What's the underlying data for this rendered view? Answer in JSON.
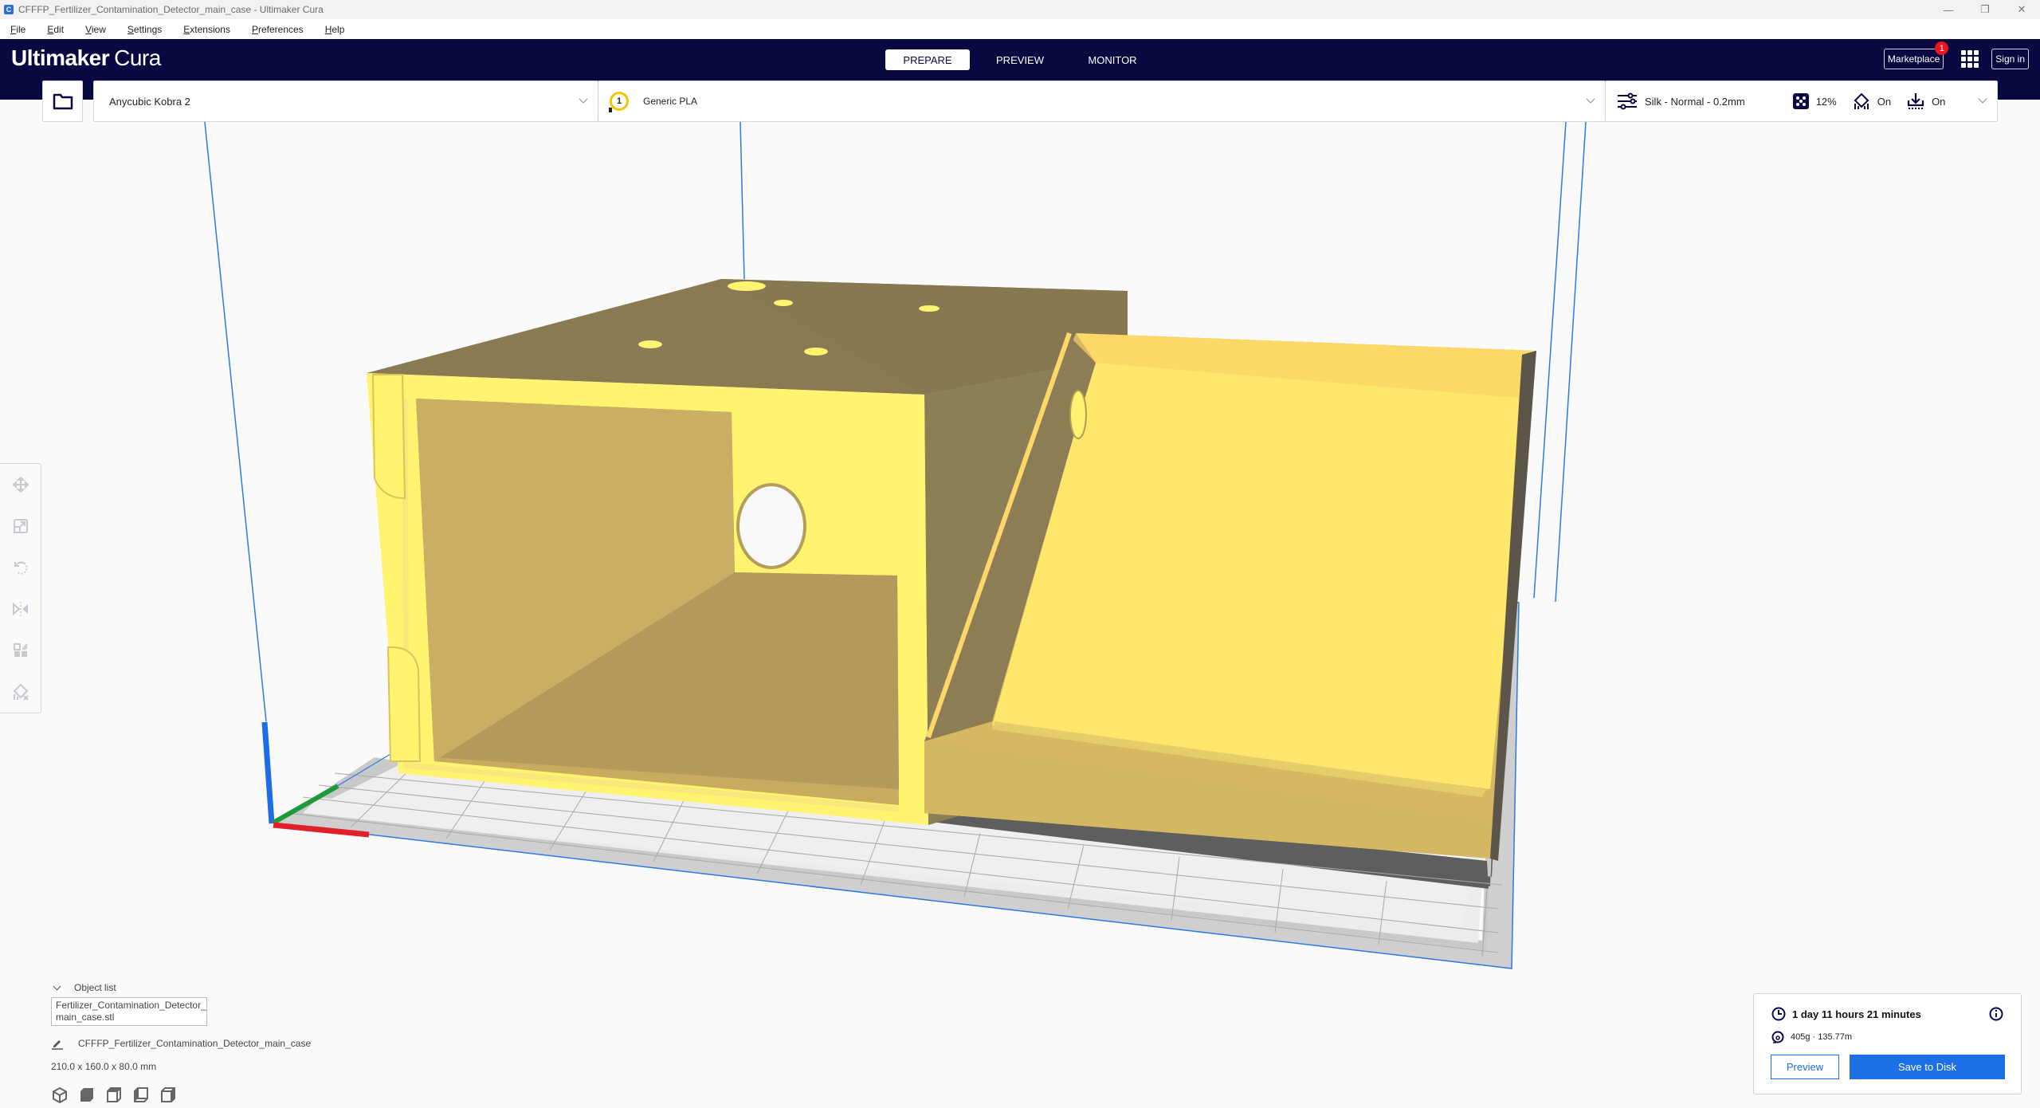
{
  "window": {
    "title": "CFFFP_Fertilizer_Contamination_Detector_main_case - Ultimaker Cura",
    "app_icon_letter": "C",
    "controls": {
      "minimize": "—",
      "maximize": "❐",
      "close": "✕"
    }
  },
  "menu": [
    "File",
    "Edit",
    "View",
    "Settings",
    "Extensions",
    "Preferences",
    "Help"
  ],
  "header": {
    "logo_bold": "Ultimaker",
    "logo_light": "Cura",
    "stages": [
      {
        "label": "PREPARE",
        "active": true
      },
      {
        "label": "PREVIEW",
        "active": false
      },
      {
        "label": "MONITOR",
        "active": false
      }
    ],
    "marketplace_label": "Marketplace",
    "marketplace_badge": "1",
    "signin_label": "Sign in"
  },
  "toolbar": {
    "printer": "Anycubic Kobra 2",
    "extruder_number": "1",
    "material": "Generic PLA",
    "profile": "Silk - Normal - 0.2mm",
    "infill": "12%",
    "support": "On",
    "adhesion": "On"
  },
  "tools": [
    "move-icon",
    "scale-icon",
    "rotate-icon",
    "mirror-icon",
    "per-model-settings-icon",
    "support-blocker-icon"
  ],
  "scene": {
    "model_color": "#f5d76e",
    "bed_color": "#e4e4e4",
    "volume_line_color": "#2a7ae4",
    "axis_colors": {
      "x": "#e0202a",
      "y": "#1e9a3a",
      "z": "#1b6ee6"
    }
  },
  "object_list": {
    "heading": "Object list",
    "file": "Fertilizer_Contamination_Detector_main_case.stl",
    "file_line1": "Fertilizer_Contamination_Detector_",
    "file_line2": "main_case.stl",
    "job_name": "CFFFP_Fertilizer_Contamination_Detector_main_case",
    "dimensions": "210.0 x 160.0 x 80.0 mm",
    "view_buttons": [
      "3d-view-icon",
      "front-view-icon",
      "top-view-icon",
      "left-view-icon",
      "right-view-icon"
    ]
  },
  "print_panel": {
    "time": "1 day 11 hours 21 minutes",
    "material_usage": "405g · 135.77m",
    "preview_label": "Preview",
    "save_label": "Save to Disk"
  }
}
